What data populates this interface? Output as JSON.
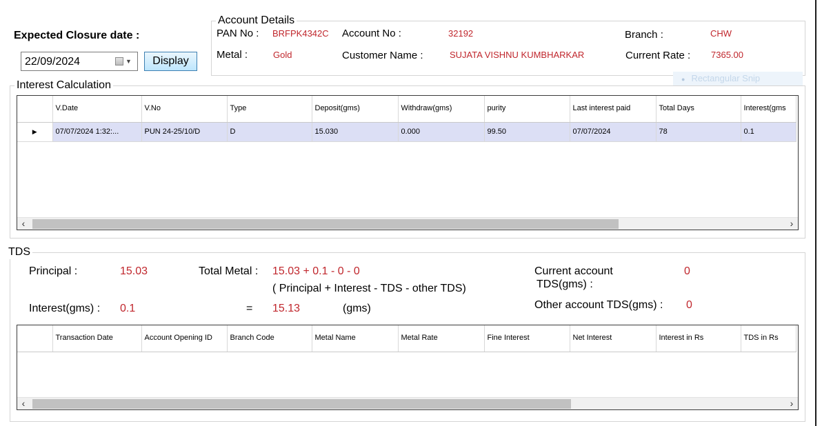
{
  "closure": {
    "label": "Expected Closure date :",
    "date_value": "22/09/2024",
    "display_button": "Display"
  },
  "account_details": {
    "title": "Account Details",
    "pan_label": "PAN No :",
    "pan_value": "BRFPK4342C",
    "account_no_label": "Account No :",
    "account_no_value": "32192",
    "branch_label": "Branch :",
    "branch_value": "CHW",
    "metal_label": "Metal :",
    "metal_value": "Gold",
    "customer_label": "Customer Name :",
    "customer_value": "SUJATA VISHNU KUMBHARKAR",
    "rate_label": "Current Rate :",
    "rate_value": "7365.00"
  },
  "overlay": {
    "snip_label": "Rectangular Snip"
  },
  "interest_calc": {
    "title": "Interest Calculation",
    "columns": [
      "V.Date",
      "V.No",
      "Type",
      "Deposit(gms)",
      "Withdraw(gms)",
      "purity",
      "Last interest paid",
      "Total Days",
      "Interest(gms"
    ],
    "rows": [
      {
        "indicator": "▶",
        "cells": [
          "07/07/2024 1:32:...",
          "PUN 24-25/10/D",
          "D",
          "15.030",
          "0.000",
          "99.50",
          "07/07/2024",
          "78",
          "0.1"
        ]
      }
    ]
  },
  "tds": {
    "title": "TDS",
    "principal_label": "Principal :",
    "principal_value": "15.03",
    "total_metal_label": "Total Metal :",
    "total_metal_expr": "15.03 + 0.1 - 0 - 0",
    "formula_note": "( Principal + Interest - TDS - other TDS)",
    "interest_label": "Interest(gms) :",
    "interest_value": "0.1",
    "equals": "=",
    "total_value": "15.13",
    "unit": "(gms)",
    "current_tds_label_line1": "Current account",
    "current_tds_label_line2": "TDS(gms) :",
    "current_tds_value": "0",
    "other_tds_label": "Other account TDS(gms) :",
    "other_tds_value": "0",
    "columns": [
      "Transaction Date",
      "Account Opening ID",
      "Branch Code",
      "Metal Name",
      "Metal Rate",
      "Fine Interest",
      "Net Interest",
      "Interest in Rs",
      "TDS in Rs"
    ]
  }
}
